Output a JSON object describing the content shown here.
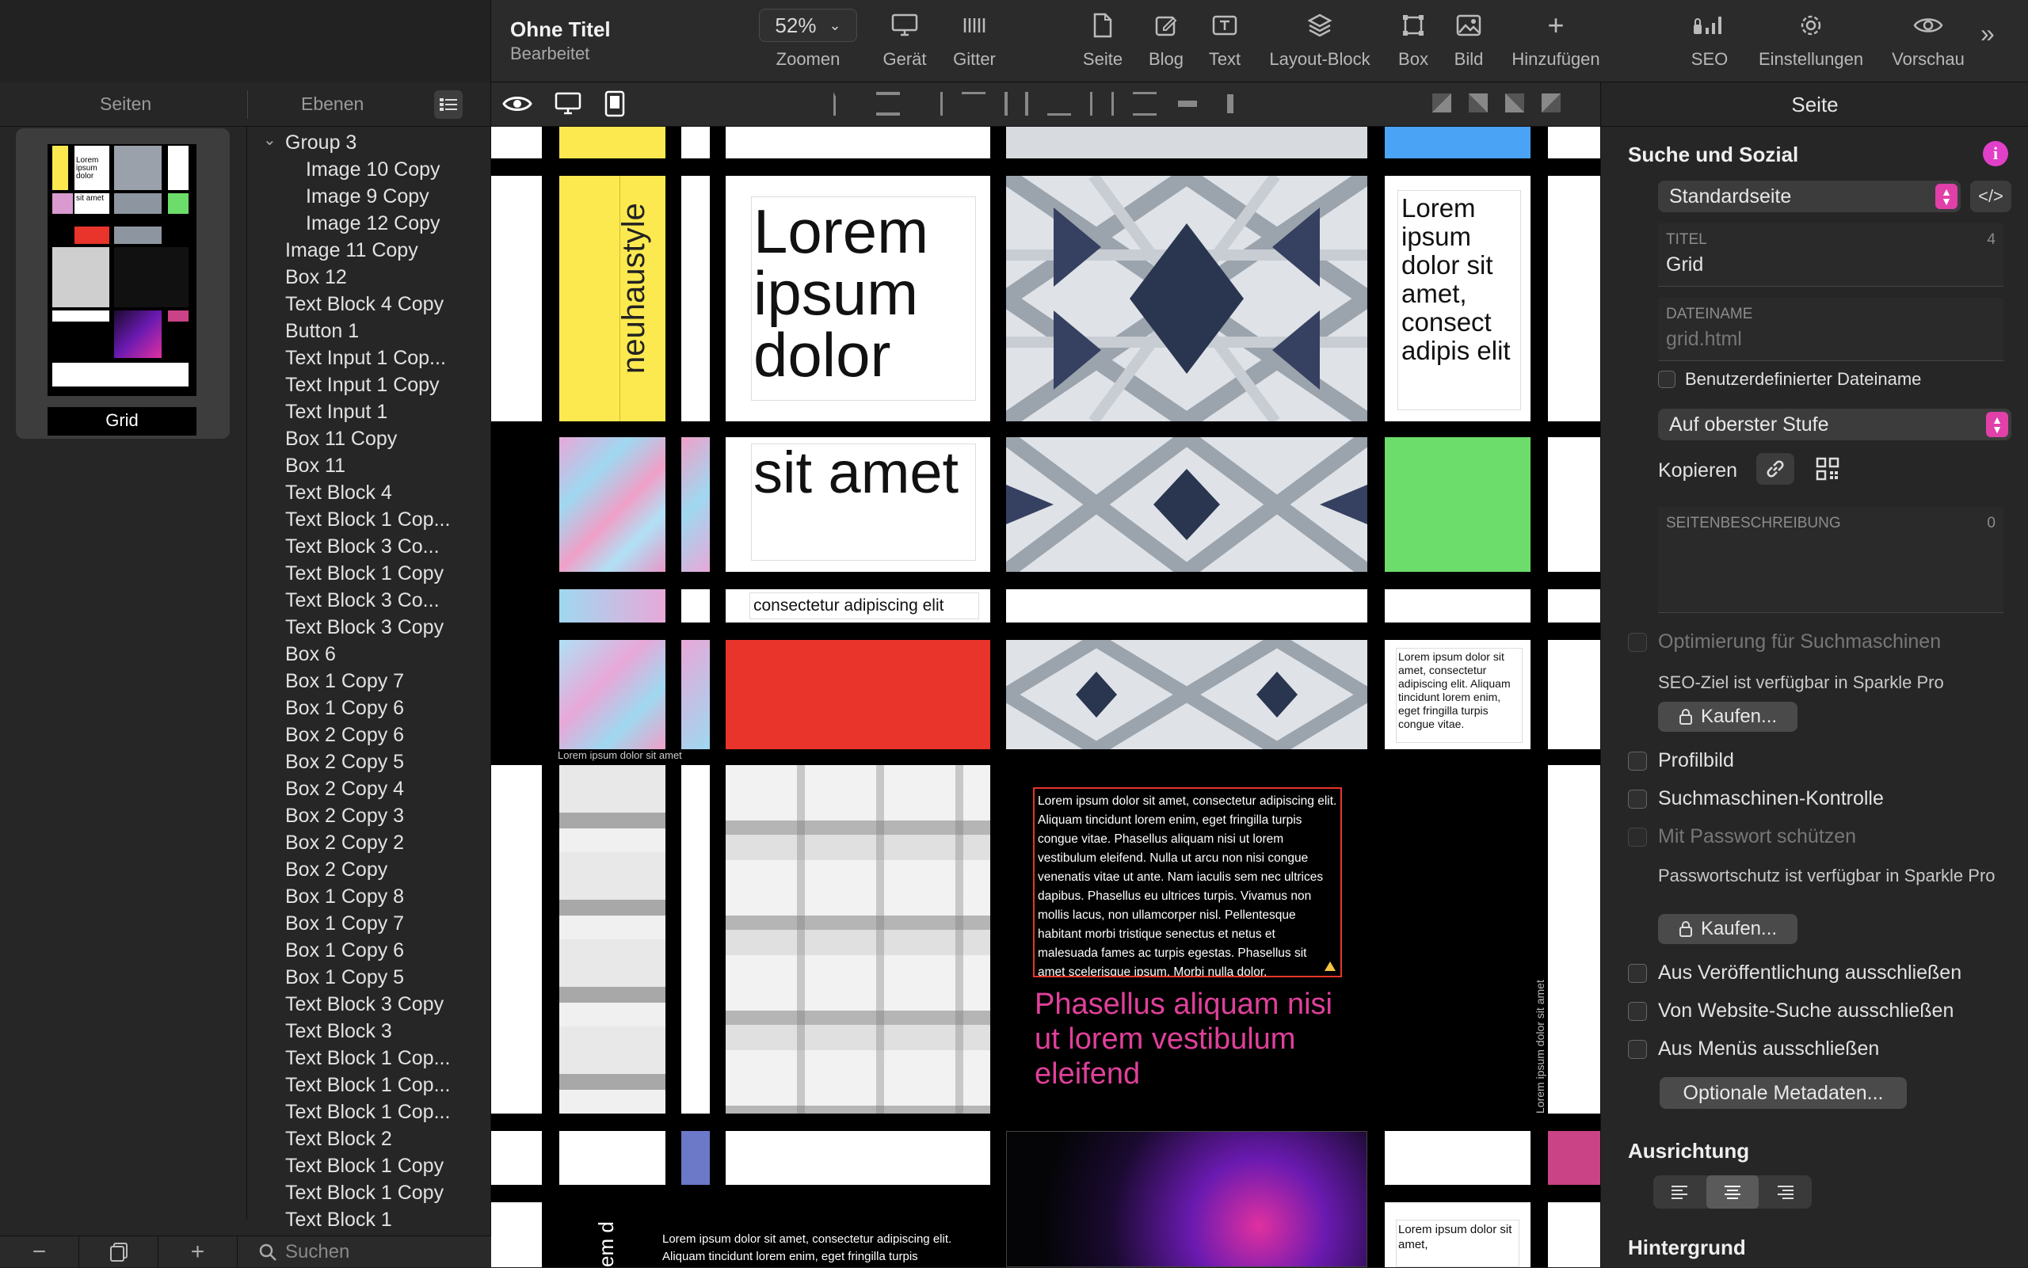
{
  "document": {
    "title": "Ohne Titel",
    "subtitle": "Bearbeitet"
  },
  "toolbar": {
    "zoom_value": "52%",
    "zoom_label": "Zoomen",
    "device_label": "Gerät",
    "grid_label": "Gitter",
    "page_label": "Seite",
    "blog_label": "Blog",
    "text_label": "Text",
    "layout_block_label": "Layout-Block",
    "box_label": "Box",
    "image_label": "Bild",
    "add_label": "Hinzufügen",
    "seo_label": "SEO",
    "settings_label": "Einstellungen",
    "preview_label": "Vorschau",
    "more_icon": "double-chevron-right-icon"
  },
  "sidebar": {
    "tab_pages": "Seiten",
    "tab_layers": "Ebenen",
    "page_thumb_name": "Grid",
    "layers": [
      "Group 3",
      "Image 10 Copy",
      "Image 9 Copy",
      "Image 12 Copy",
      "Image 11 Copy",
      "Box 12",
      "Text Block 4 Copy",
      "Button 1",
      "Text Input 1 Cop...",
      "Text Input 1 Copy",
      "Text Input 1",
      "Box 11 Copy",
      "Box 11",
      "Text Block 4",
      "Text Block 1 Cop...",
      "Text Block 3 Co...",
      "Text Block 1 Copy",
      "Text Block 3 Co...",
      "Text Block 3 Copy",
      "Box 6",
      "Box 1 Copy 7",
      "Box 1 Copy 6",
      "Box 2 Copy 6",
      "Box 2 Copy 5",
      "Box 2 Copy 4",
      "Box 2 Copy 3",
      "Box 2 Copy 2",
      "Box 2 Copy",
      "Box 1 Copy 8",
      "Box 1 Copy 7",
      "Box 1 Copy 6",
      "Box 1 Copy 5",
      "Text Block 3 Copy",
      "Text Block 3",
      "Text Block 1 Cop...",
      "Text Block 1 Cop...",
      "Text Block 1 Cop...",
      "Text Block 2",
      "Text Block 1 Copy",
      "Text Block 1 Copy",
      "Text Block 1"
    ],
    "search_placeholder": "Suchen",
    "btn_minus": "−",
    "btn_plus": "+"
  },
  "canvas": {
    "thumb_lorem": "Lorem ipsum dolor",
    "thumb_sit": "sit amet",
    "vertical_brand": "neuhaustyle",
    "big_lorem": "Lorem ipsum dolor",
    "big_sit": "sit amet",
    "small_consectetur": "consectetur adipiscing elit",
    "right_lorem": "Lorem ipsum dolor sit amet, consect adipis elit",
    "right_small_para": "Lorem ipsum dolor sit amet, consectetur adipiscing elit. Aliquam tincidunt lorem enim, eget fringilla turpis congue vitae.",
    "caption_small": "Lorem ipsum dolor sit amet",
    "body_para": "Lorem ipsum dolor sit amet, consectetur adipiscing elit. Aliquam tincidunt lorem enim, eget fringilla turpis congue vitae. Phasellus aliquam nisi ut lorem vestibulum eleifend. Nulla ut arcu non nisi congue venenatis vitae ut ante. Nam iaculis sem nec ultrices dapibus. Phasellus eu ultrices turpis. Vivamus non mollis lacus, non ullamcorper nisl. Pellentesque habitant morbi tristique senectus et netus et malesuada fames ac turpis egestas. Phasellus sit amet scelerisque ipsum. Morbi nulla dolor.",
    "pink_heading": "Phasellus aliquam nisi ut lorem vestibulum eleifend",
    "vertical_caption": "Lorem ipsum dolor sit amet",
    "bottom_para": "Lorem ipsum dolor sit amet, consectetur adipiscing elit. Aliquam tincidunt lorem enim, eget fringilla turpis",
    "bottom_right_para": "Lorem ipsum dolor sit amet,",
    "bottom_vertical": "em d"
  },
  "right_panel": {
    "title": "Seite",
    "section_seo": "Suche und Sozial",
    "page_type": "Standardseite",
    "code_label": "</>",
    "title_caption": "TITEL",
    "title_count": "4",
    "title_value": "Grid",
    "filename_caption": "DATEINAME",
    "filename_value": "grid.html",
    "custom_filename": "Benutzerdefinierter Dateiname",
    "level": "Auf oberster Stufe",
    "copy_label": "Kopieren",
    "desc_caption": "SEITENBESCHREIBUNG",
    "desc_count": "0",
    "seo_opt": "Optimierung für Suchmaschinen",
    "seo_note": "SEO-Ziel ist verfügbar in Sparkle Pro",
    "buy_label": "Kaufen...",
    "profile_image": "Profilbild",
    "search_control": "Suchmaschinen-Kontrolle",
    "password": "Mit Passwort schützen",
    "password_note": "Passwortschutz ist verfügbar in Sparkle Pro",
    "exclude_publish": "Aus Veröffentlichung ausschließen",
    "exclude_search": "Von Website-Suche ausschließen",
    "exclude_menus": "Aus Menüs ausschließen",
    "optional_meta": "Optionale Metadaten...",
    "alignment": "Ausrichtung",
    "background": "Hintergrund"
  },
  "colors": {
    "accent_pink": "#e040a8",
    "yellow": "#fce94f",
    "green": "#6cdd6a",
    "red": "#e8342a",
    "blue": "#4aa3f5",
    "magenta": "#c94386",
    "periwinkle": "#6c78c8"
  }
}
